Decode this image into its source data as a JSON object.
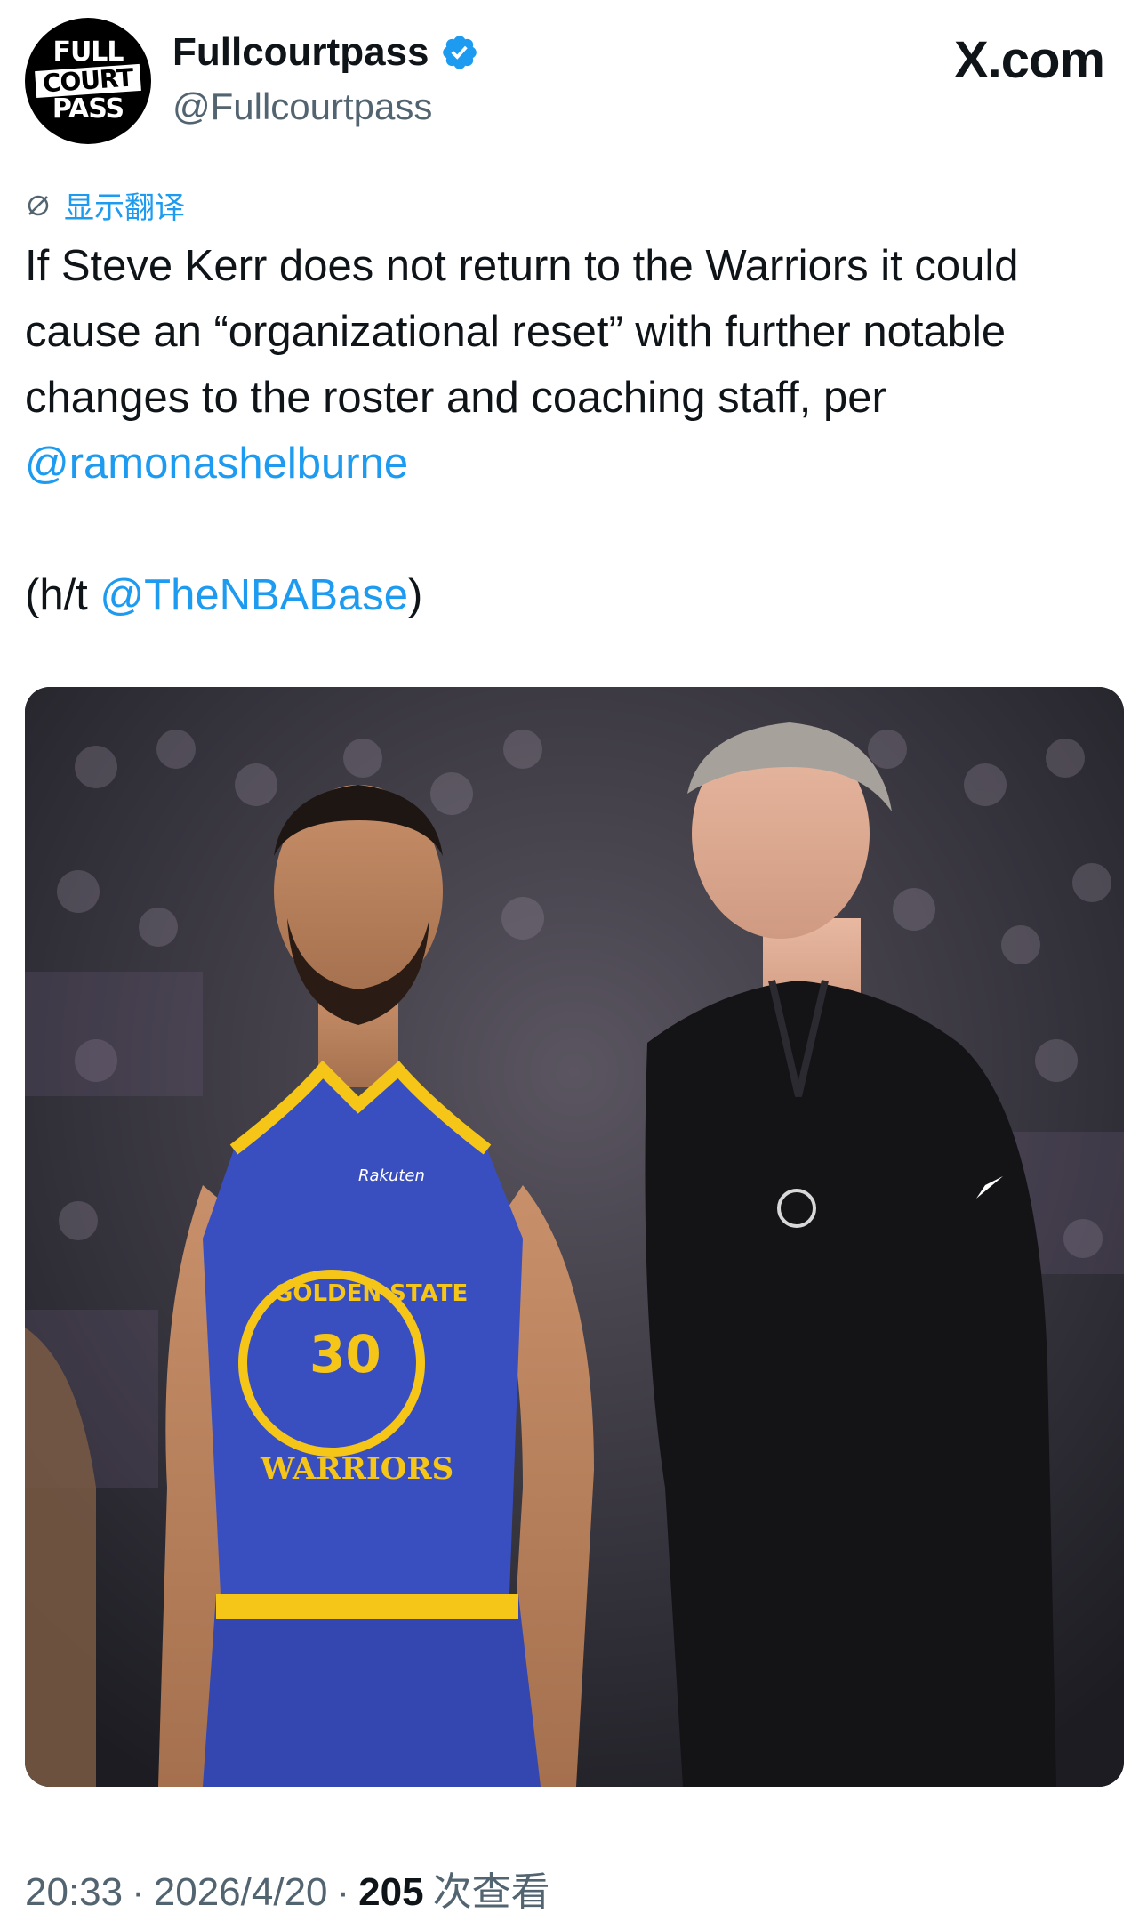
{
  "account": {
    "avatar_text": [
      "FULL",
      "COURT",
      "PASS"
    ],
    "display_name": "Fullcourtpass",
    "handle": "@Fullcourtpass",
    "verified": true
  },
  "brand": "X.com",
  "translate_label": "显示翻译",
  "tweet": {
    "line1": "If Steve Kerr does not return to the Warriors it could cause an “organizational reset” with further notable changes to the roster and coaching staff, per ",
    "mention1": "@ramonashelburne",
    "line2_prefix": "(h/t ",
    "mention2": "@TheNBABase",
    "line2_suffix": ")"
  },
  "media": {
    "jersey_text": "GOLDEN STATE",
    "jersey_number": "30",
    "jersey_team": "WARRIORS",
    "sponsor": "Rakuten"
  },
  "footer": {
    "time": "20:33",
    "separator": "·",
    "date": "2026/4/20",
    "views_count": "205",
    "views_label": "次查看"
  },
  "colors": {
    "link": "#1d9bf0",
    "text": "#0f1419",
    "muted": "#536471",
    "jersey_blue": "#3a4fbf",
    "jersey_yellow": "#f5c518"
  }
}
